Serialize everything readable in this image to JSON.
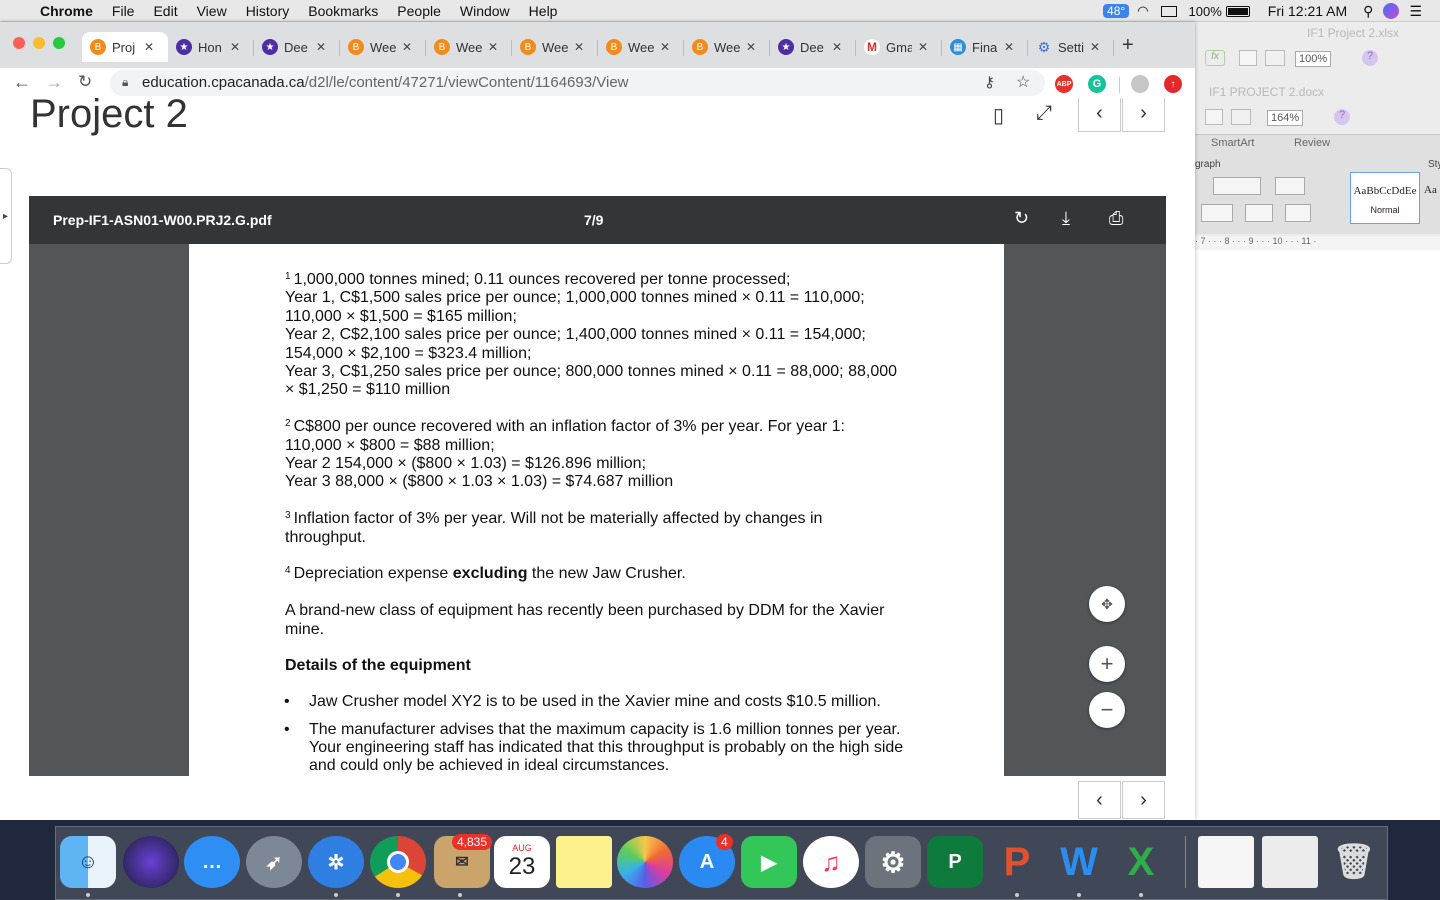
{
  "menubar": {
    "app": "Chrome",
    "items": [
      "File",
      "Edit",
      "View",
      "History",
      "Bookmarks",
      "People",
      "Window",
      "Help"
    ],
    "temp": "48°",
    "battery": "100%",
    "clock": "Fri 12:21 AM"
  },
  "bgapp": {
    "excel_title": "IF1 Project 2.xlsx",
    "excel_zoom": "100%",
    "word_title": "IF1 PROJECT 2.docx",
    "word_zoom": "164%",
    "tab_smartart": "SmartArt",
    "tab_review": "Review",
    "group_paragraph": "graph",
    "group_styles": "Sty",
    "style_sample": "AaBbCcDdEe",
    "style_name": "Normal",
    "style_sample2": "Aa",
    "ruler": "· 7 · · · 8 · · · 9 · · · 10 · · · 11 ·"
  },
  "tabs": [
    {
      "title": "Proj",
      "icon": "letter-b-icon",
      "color": "#f28b1e",
      "active": true
    },
    {
      "title": "Hon",
      "icon": "star-icon",
      "color": "#4b2fa3"
    },
    {
      "title": "Dee",
      "icon": "star-icon",
      "color": "#4b2fa3"
    },
    {
      "title": "Wee",
      "icon": "letter-b-icon",
      "color": "#f28b1e"
    },
    {
      "title": "Wee",
      "icon": "letter-b-icon",
      "color": "#f28b1e"
    },
    {
      "title": "Wee",
      "icon": "letter-b-icon",
      "color": "#f28b1e"
    },
    {
      "title": "Wee",
      "icon": "letter-b-icon",
      "color": "#f28b1e"
    },
    {
      "title": "Wee",
      "icon": "letter-b-icon",
      "color": "#f28b1e"
    },
    {
      "title": "Dee",
      "icon": "star-icon",
      "color": "#4b2fa3"
    },
    {
      "title": "Gma",
      "icon": "gmail-icon",
      "color": "#ffffff"
    },
    {
      "title": "Fina",
      "icon": "spreadsheet-icon",
      "color": "#2f8fd8"
    },
    {
      "title": "Setti",
      "icon": "gear-icon",
      "color": "#3a6fd8"
    }
  ],
  "url": {
    "host": "education.cpacanada.ca",
    "path": "/d2l/le/content/47271/viewContent/1164693/View"
  },
  "page": {
    "title": "Project 2"
  },
  "pdf": {
    "filename": "Prep-IF1-ASN01-W00.PRJ2.G.pdf",
    "page_indicator": "7/9",
    "fn1_sup": "1",
    "fn1_lines": [
      "1,000,000 tonnes mined; 0.11 ounces recovered per tonne processed;",
      "Year 1, C$1,500 sales price per ounce; 1,000,000 tonnes mined × 0.11 = 110,000;",
      "110,000 × $1,500 = $165 million;",
      "Year 2, C$2,100 sales price per ounce; 1,400,000 tonnes mined × 0.11 = 154,000;",
      "154,000 × $2,100 = $323.4 million;",
      "Year 3, C$1,250 sales price per ounce; 800,000 tonnes mined × 0.11 = 88,000; 88,000",
      "× $1,250 = $110 million"
    ],
    "fn2_sup": "2",
    "fn2_lines": [
      "C$800 per ounce recovered with an inflation factor of 3% per year. For year 1:",
      "110,000 × $800 = $88 million;",
      "Year 2 154,000 × ($800 × 1.03) = $126.896 million;",
      "Year 3 88,000 × ($800 × 1.03 × 1.03) = $74.687 million"
    ],
    "fn3_sup": "3",
    "fn3_lines": [
      "Inflation factor of 3% per year. Will not be materially affected by changes in",
      "throughput."
    ],
    "fn4_sup": "4",
    "fn4_pre": "Depreciation expense ",
    "fn4_bold": "excluding",
    "fn4_post": " the new Jaw Crusher.",
    "para_lines": [
      "A brand-new class of equipment has recently been purchased by DDM for the Xavier",
      "mine."
    ],
    "heading": "Details of the equipment",
    "bullets": [
      [
        "Jaw Crusher model XY2 is to be used in the Xavier mine and costs $10.5 million."
      ],
      [
        "The manufacturer advises that the maximum capacity is 1.6 million tonnes per year.",
        "Your engineering staff has indicated that this throughput is probably on the high side",
        "and could only be achieved in ideal circumstances."
      ]
    ]
  },
  "dock": {
    "mail_badge": "4,835",
    "calendar_month": "AUG",
    "calendar_day": "23",
    "appstore_badge": "4"
  }
}
